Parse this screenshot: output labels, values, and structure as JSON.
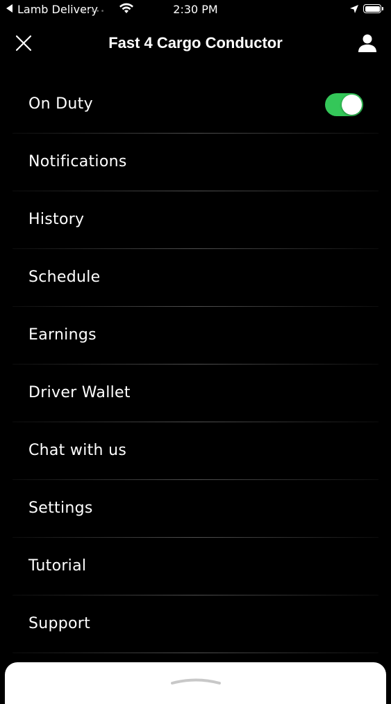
{
  "status_bar": {
    "back_label": "Lamb Delivery",
    "signal": "•••••",
    "time": "2:30 PM"
  },
  "header": {
    "title": "Fast 4 Cargo Conductor",
    "close_icon": "close-icon",
    "profile_icon": "person-icon"
  },
  "menu": {
    "on_duty": {
      "label": "On Duty",
      "toggle_on": true,
      "toggle_color": "#34c759"
    },
    "items": [
      {
        "label": "Notifications"
      },
      {
        "label": "History"
      },
      {
        "label": "Schedule"
      },
      {
        "label": "Earnings"
      },
      {
        "label": "Driver Wallet"
      },
      {
        "label": "Chat with us"
      },
      {
        "label": "Settings"
      },
      {
        "label": "Tutorial"
      },
      {
        "label": "Support"
      }
    ]
  },
  "colors": {
    "background": "#000000",
    "text": "#ffffff",
    "accent": "#34c759"
  }
}
